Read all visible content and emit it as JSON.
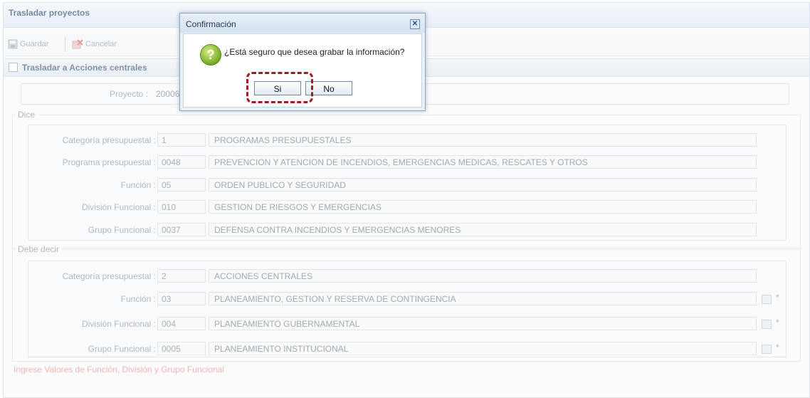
{
  "window": {
    "title": "Trasladar proyectos"
  },
  "toolbar": {
    "save_label": "Guardar",
    "cancel_label": "Cancelar"
  },
  "section": {
    "title": "Trasladar a Acciones centrales"
  },
  "project": {
    "label": "Proyecto :",
    "value": "200063"
  },
  "dice": {
    "legend": "Dice",
    "rows": [
      {
        "label": "Categoría presupuestal :",
        "code": "1",
        "desc": "PROGRAMAS PRESUPUESTALES"
      },
      {
        "label": "Programa presupuestal :",
        "code": "0048",
        "desc": "PREVENCION Y ATENCION DE INCENDIOS, EMERGENCIAS MEDICAS, RESCATES Y OTROS"
      },
      {
        "label": "Función :",
        "code": "05",
        "desc": "ORDEN PUBLICO Y SEGURIDAD"
      },
      {
        "label": "División Funcional :",
        "code": "010",
        "desc": "GESTION DE RIESGOS Y EMERGENCIAS"
      },
      {
        "label": "Grupo Funcional :",
        "code": "0037",
        "desc": "DEFENSA CONTRA INCENDIOS Y EMERGENCIAS MENORES"
      }
    ]
  },
  "debe_decir": {
    "legend": "Debe decir",
    "rows": [
      {
        "label": "Categoría presupuestal :",
        "code": "2",
        "desc": "ACCIONES CENTRALES"
      },
      {
        "label": "Función :",
        "code": "03",
        "desc": "PLANEAMIENTO, GESTION Y RESERVA DE CONTINGENCIA",
        "required": "*"
      },
      {
        "label": "División Funcional :",
        "code": "004",
        "desc": "PLANEAMIENTO GUBERNAMENTAL",
        "required": "*"
      },
      {
        "label": "Grupo Funcional :",
        "code": "0005",
        "desc": "PLANEAMIENTO INSTITUCIONAL",
        "required": "*"
      }
    ]
  },
  "footer_message": "Ingrese Valores de Función, División y Grupo Funcional",
  "dialog": {
    "title": "Confirmación",
    "message": "¿Está seguro que desea grabar la información?",
    "yes_label": "Si",
    "no_label": "No",
    "close_icon": "close-icon",
    "question_icon": "question-icon"
  },
  "colors": {
    "highlight": "#a11b1b",
    "required": "#e06666",
    "title_text": "#2c4a6b"
  }
}
